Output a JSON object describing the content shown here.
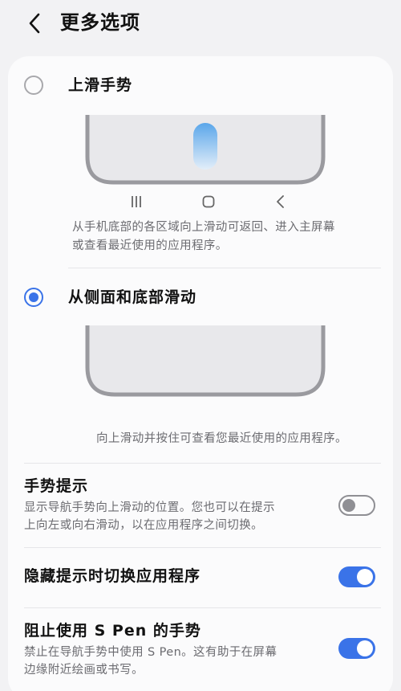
{
  "header": {
    "title": "更多选项"
  },
  "options": [
    {
      "label": "上滑手势",
      "selected": false,
      "description_line1": "从手机底部的各区域向上滑动可返回、进入主屏幕",
      "description_line2": "或查看最近使用的应用程序。"
    },
    {
      "label": "从侧面和底部滑动",
      "selected": true,
      "description_line1": "向上滑动并按住可查看您最近使用的应用程序。"
    }
  ],
  "settings": [
    {
      "title": "手势提示",
      "description_line1": "显示导航手势向上滑动的位置。您也可以在提示",
      "description_line2": "上向左或向右滑动，以在应用程序之间切换。",
      "enabled": false
    },
    {
      "title": "隐藏提示时切换应用程序",
      "enabled": true
    },
    {
      "title": "阻止使用 S Pen 的手势",
      "description_line1": "禁止在导航手势中使用 S Pen。这有助于在屏幕",
      "description_line2": "边缘附近绘画或书写。",
      "enabled": true
    }
  ],
  "colors": {
    "accent": "#3a73e8",
    "background": "#f2f2f4",
    "card": "#fbfbfc",
    "secondary_text": "#6b6b70"
  },
  "icons": {
    "back": "chevron-left-icon",
    "recents": "recents-icon",
    "home": "home-icon",
    "nav_back": "nav-back-icon"
  }
}
